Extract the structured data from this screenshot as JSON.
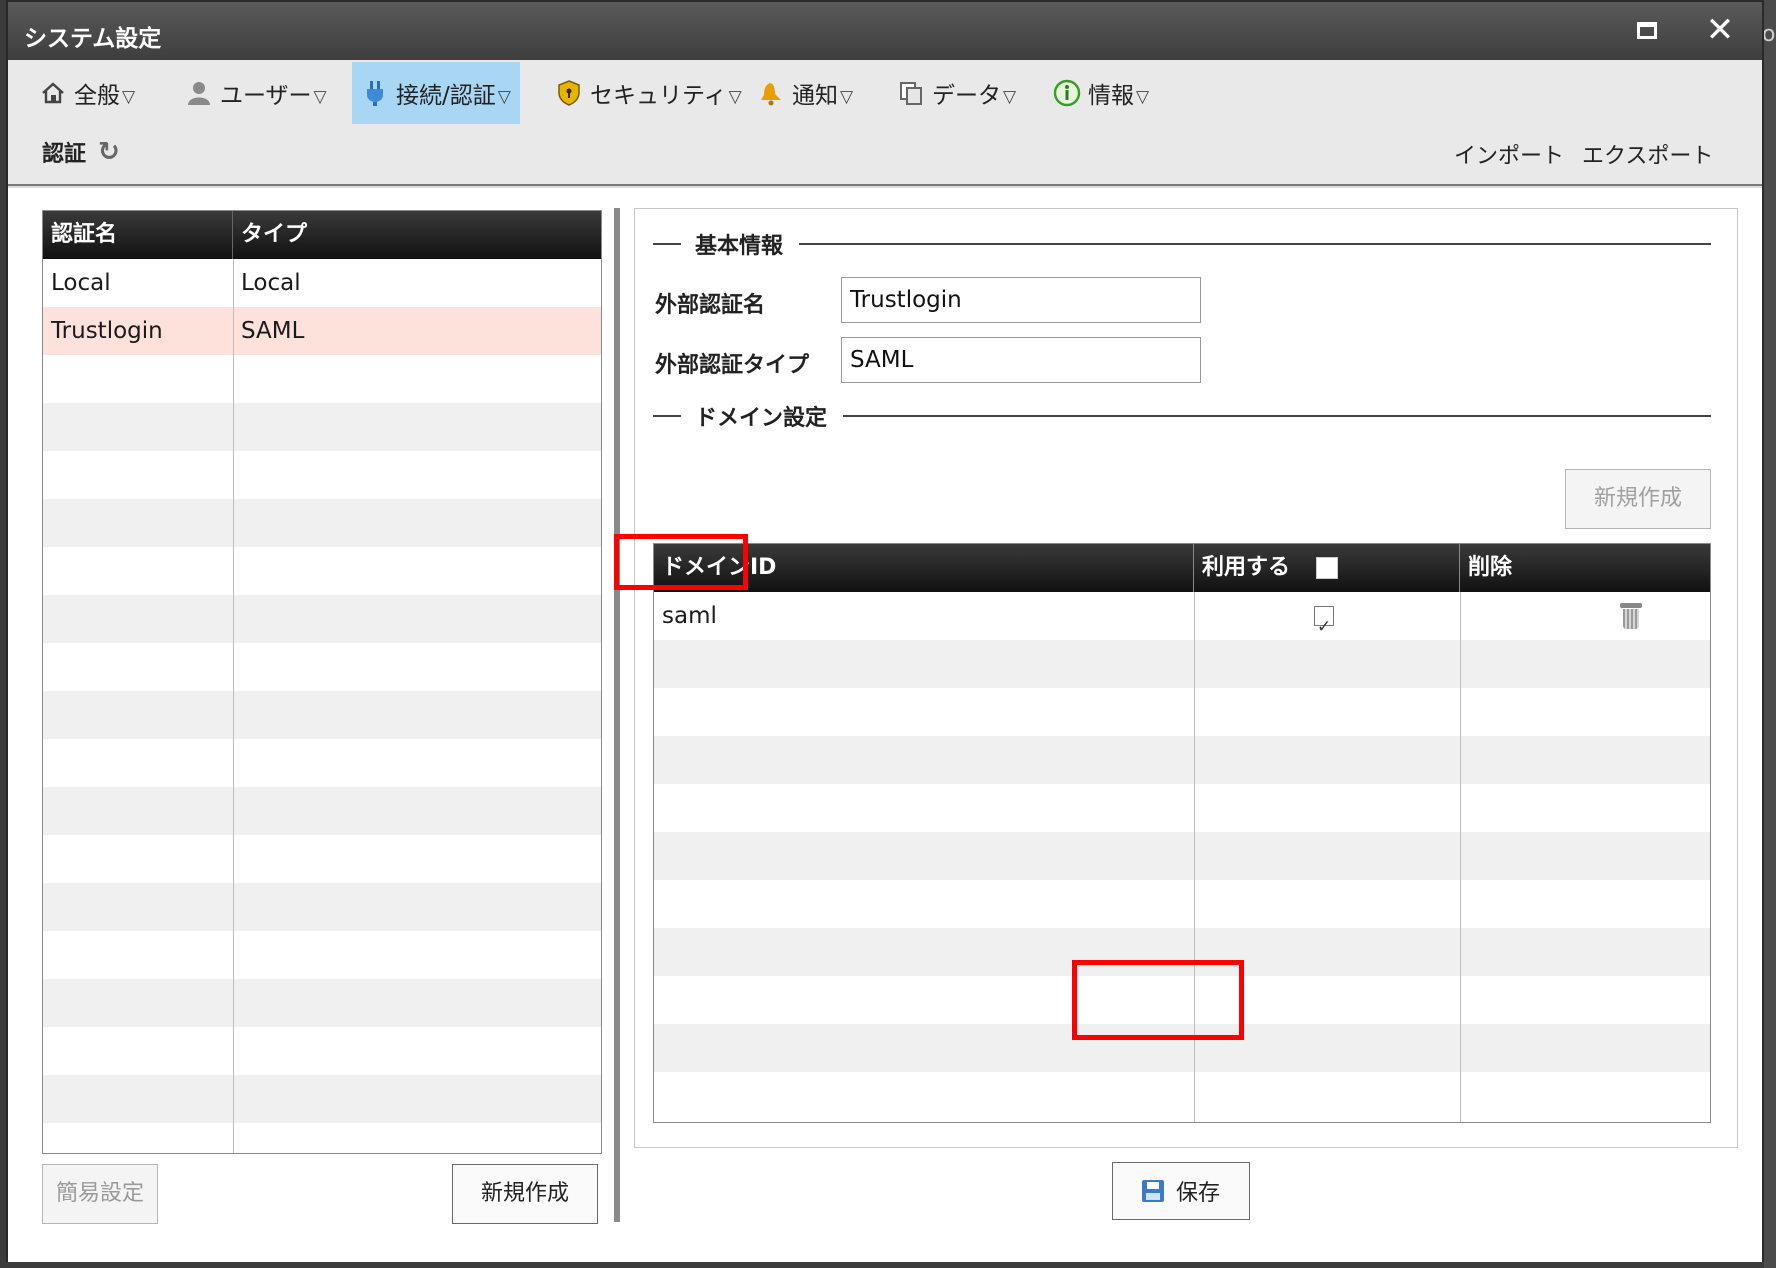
{
  "window": {
    "title": "システム設定"
  },
  "edge_text": "o",
  "menu": [
    {
      "label": "全般",
      "icon": "home-icon"
    },
    {
      "label": "ユーザー",
      "icon": "user-icon"
    },
    {
      "label": "接続/認証",
      "icon": "plug-icon",
      "active": true
    },
    {
      "label": "セキュリティ",
      "icon": "shield-icon"
    },
    {
      "label": "通知",
      "icon": "bell-icon"
    },
    {
      "label": "データ",
      "icon": "copy-icon"
    },
    {
      "label": "情報",
      "icon": "info-icon"
    }
  ],
  "section": {
    "title": "認証",
    "import_label": "インポート",
    "export_label": "エクスポート"
  },
  "auth_table": {
    "columns": [
      "認証名",
      "タイプ"
    ],
    "rows": [
      {
        "name": "Local",
        "type": "Local"
      },
      {
        "name": "Trustlogin",
        "type": "SAML",
        "selected": true
      }
    ]
  },
  "left_buttons": {
    "easy_setup": "簡易設定",
    "new": "新規作成"
  },
  "form": {
    "basic_section": "基本情報",
    "ext_auth_name_label": "外部認証名",
    "ext_auth_name_value": "Trustlogin",
    "ext_auth_type_label": "外部認証タイプ",
    "ext_auth_type_value": "SAML",
    "domain_section": "ドメイン設定",
    "new_button": "新規作成"
  },
  "domain_table": {
    "columns": [
      "ドメインID",
      "利用する",
      "削除"
    ],
    "rows": [
      {
        "domain_id": "saml",
        "use": true
      }
    ]
  },
  "save_button": "保存",
  "colors": {
    "active_menu": "#a9d6f2",
    "selected_row": "#fde2dc",
    "highlight": "#ff0000",
    "header_bg": "#1a1a1a"
  }
}
